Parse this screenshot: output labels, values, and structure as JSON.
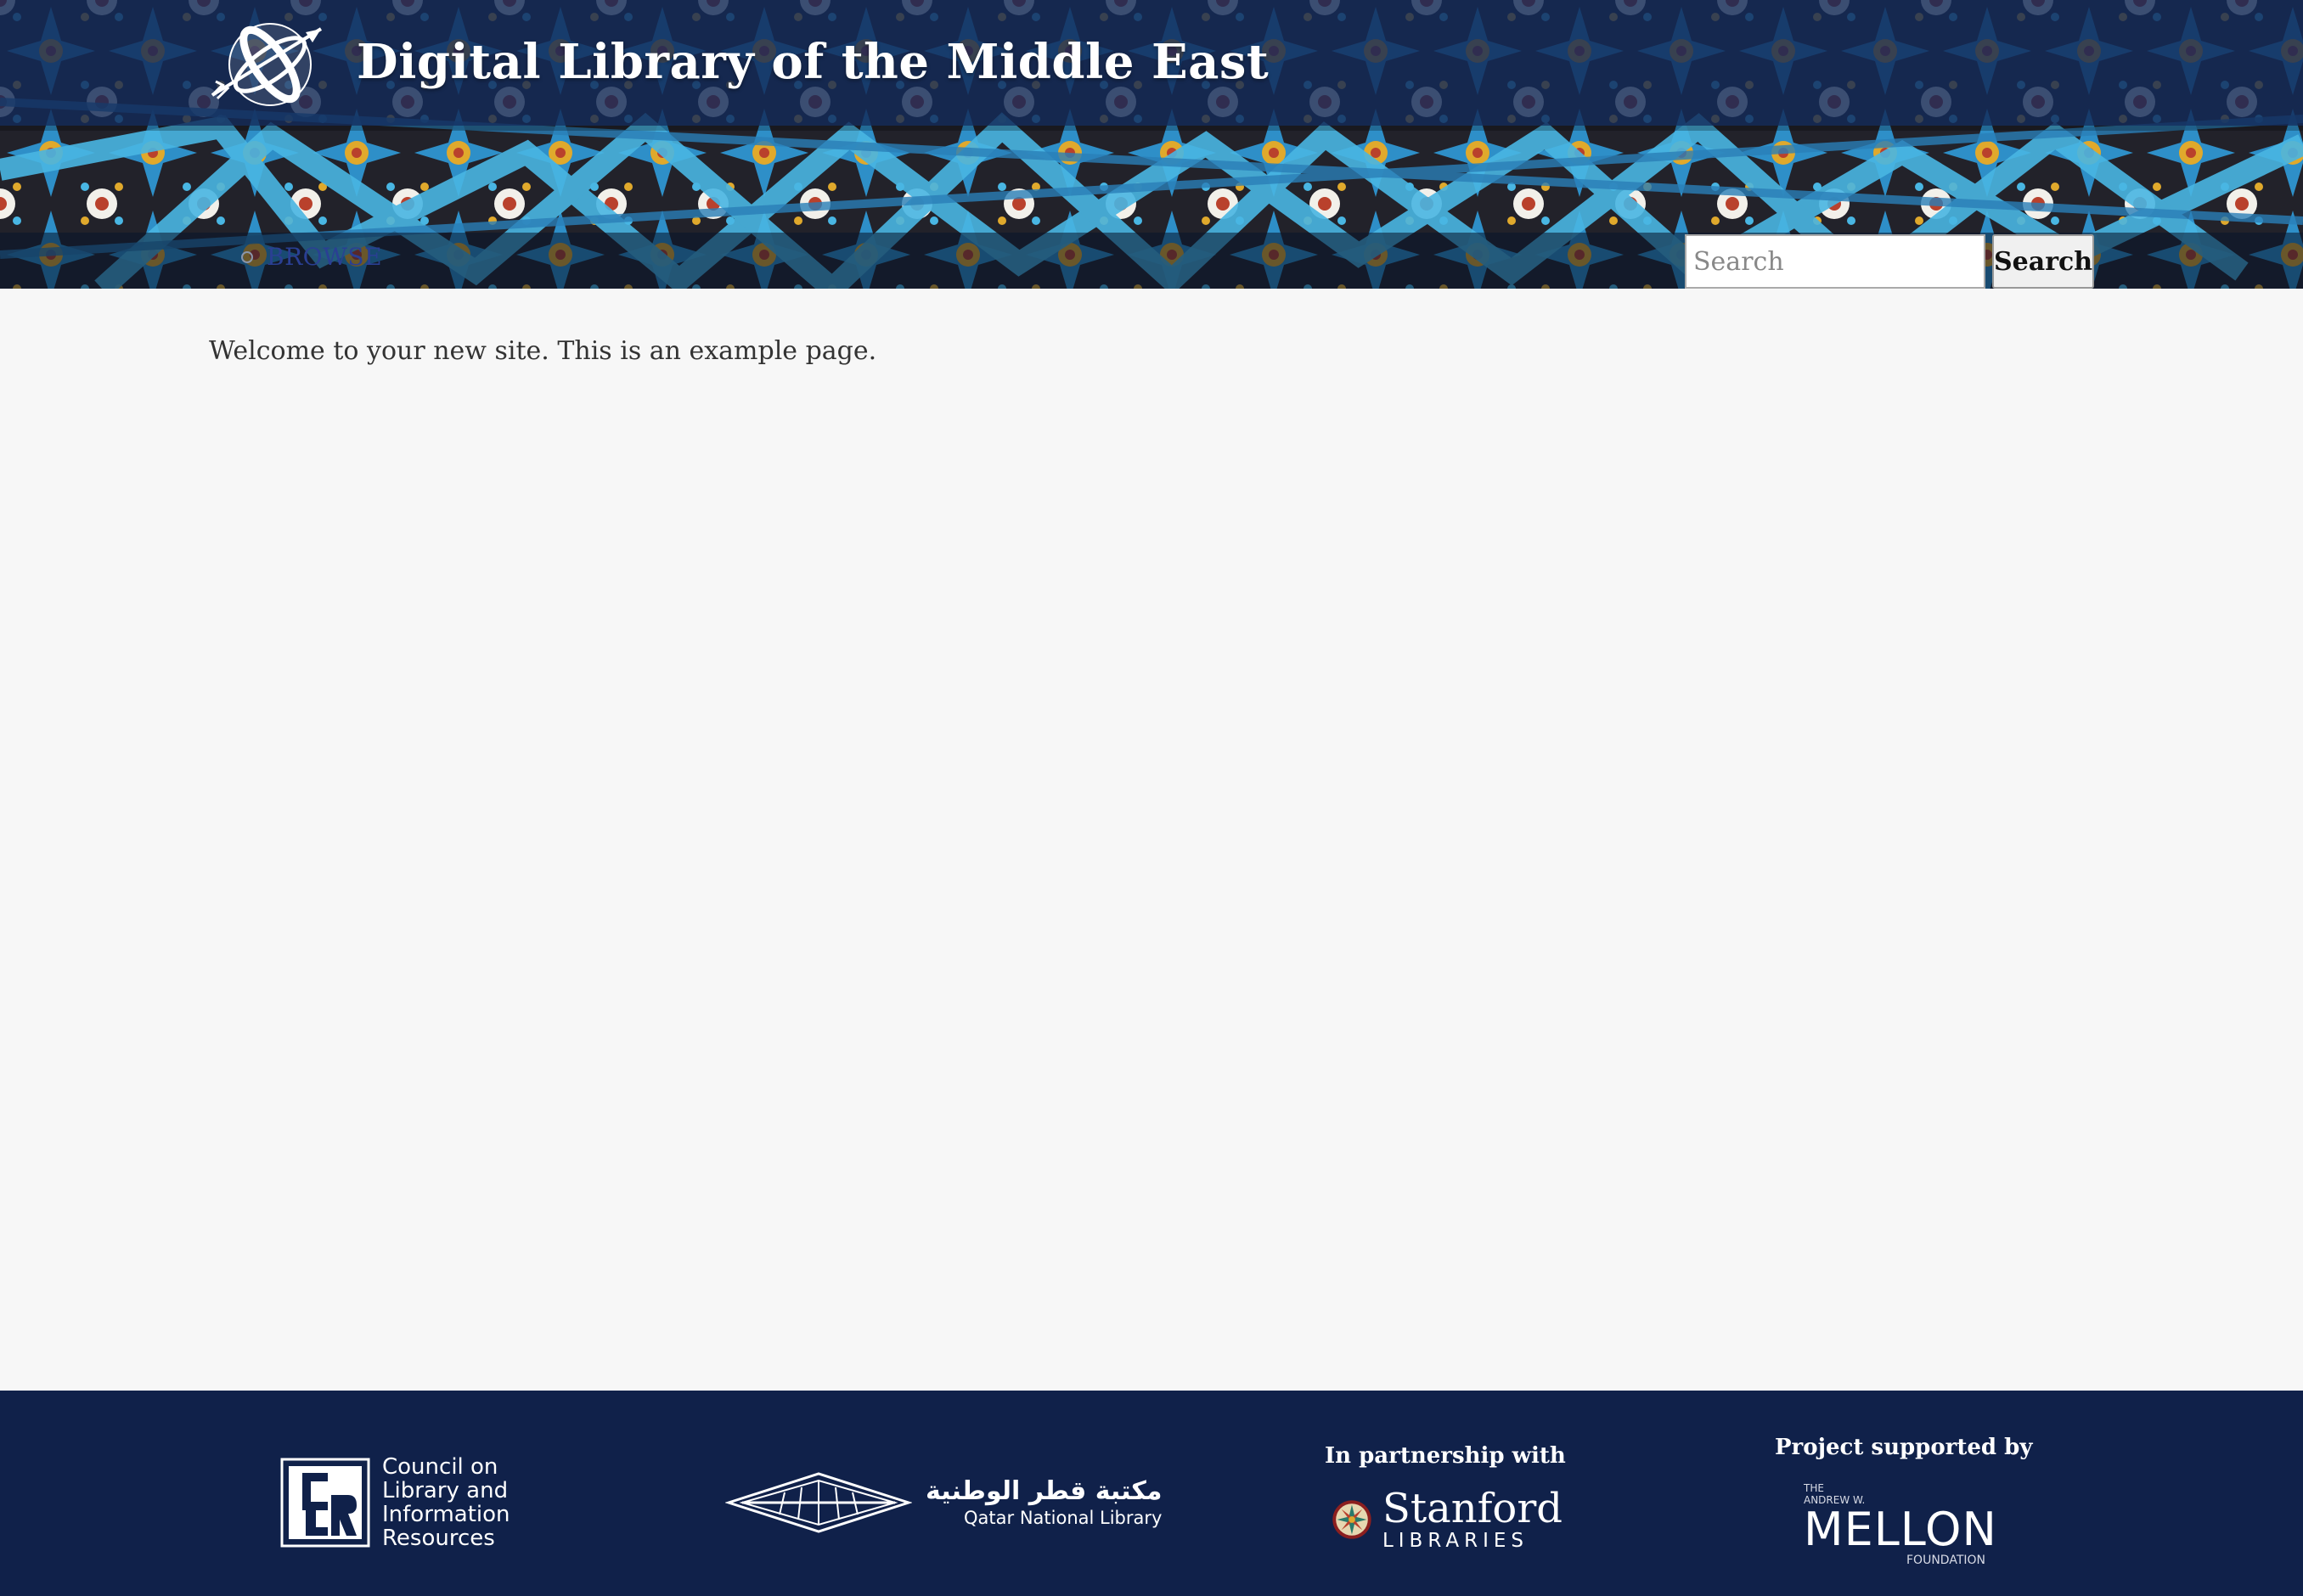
{
  "colors": {
    "header_band": "#1b3769",
    "footer_bg": "#10214a",
    "page_bg": "#f7f7f7",
    "nav_link": "#2a3f93",
    "tile_blue": "#2e8fc8",
    "tile_cyan": "#49b6e3",
    "tile_red": "#b9412c",
    "tile_gold": "#e0a92c",
    "tile_dark": "#1e1c24"
  },
  "header": {
    "logo_icon": "globe-arrow-icon",
    "title": "Digital Library of the Middle East"
  },
  "nav": {
    "items": [
      {
        "label": "BROWSE"
      }
    ]
  },
  "search": {
    "placeholder": "Search",
    "value": "",
    "button_label": "Search"
  },
  "main": {
    "welcome_text": "Welcome to your new site. This is an example page."
  },
  "footer": {
    "clir": {
      "line1": "Council on",
      "line2": "Library and",
      "line3": "Information",
      "line4": "Resources"
    },
    "qnl": {
      "arabic": "مكتبة قطر الوطنية",
      "english": "Qatar National Library"
    },
    "partner": {
      "caption": "In partnership with",
      "name": "Stanford",
      "sub": "LIBRARIES"
    },
    "support": {
      "caption": "Project supported by",
      "line1": "THE",
      "line2": "ANDREW W.",
      "name": "MELLON",
      "foundation": "FOUNDATION"
    }
  }
}
